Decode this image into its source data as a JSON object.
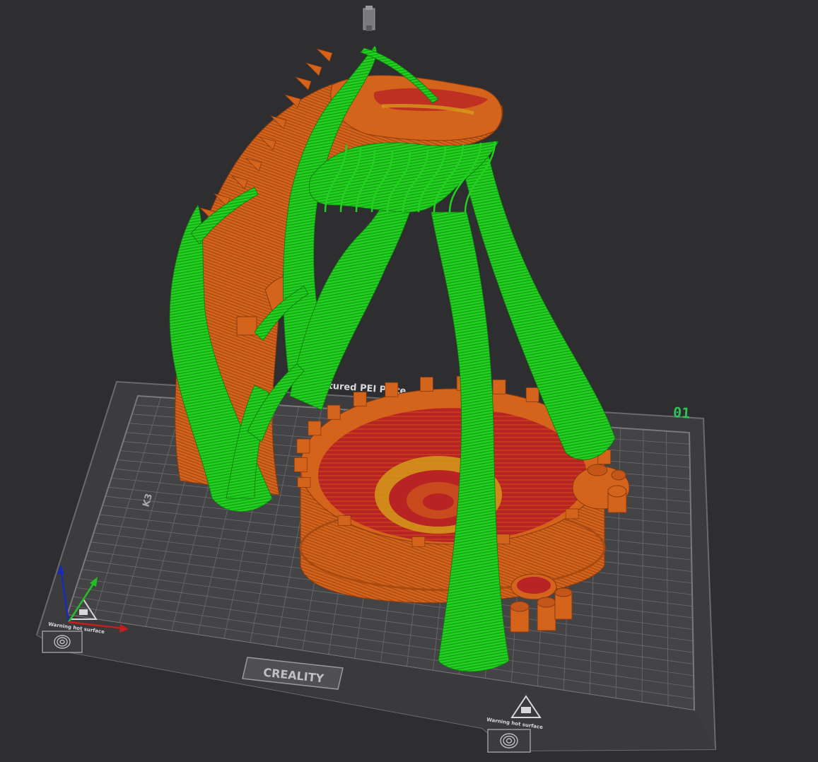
{
  "viewport": {
    "background_color": "#2e2e30"
  },
  "build_plate": {
    "plate_number": "01",
    "brand": "CREALITY",
    "surface_text": "Textured PEI Plate",
    "warning_text": "Warning hot surface",
    "corner_mark": "K3",
    "colors": {
      "plate": "#3c3c3e",
      "grid": "#8b8b8d",
      "rim": "#6a6a6c",
      "plate_number": "#2ec25a"
    }
  },
  "model": {
    "colors": {
      "wall_orange": "#d4641c",
      "wall_shadow": "#a84a12",
      "infill_red": "#b82424",
      "top_yellow": "#d49a1a",
      "support_green": "#22d020",
      "support_dark": "#149a14"
    }
  },
  "axes": {
    "x_color": "#c42020",
    "y_color": "#20c020",
    "z_color": "#1a2ab8"
  },
  "icons": {
    "nozzle": "nozzle-icon",
    "fingerprint": "fingerprint-icon",
    "hot_surface": "hot-surface-warning-icon"
  }
}
